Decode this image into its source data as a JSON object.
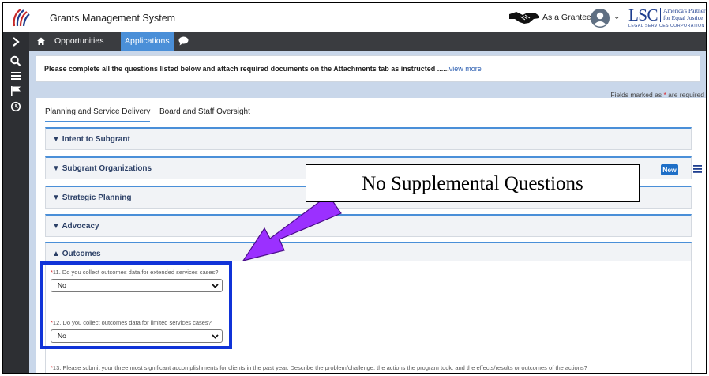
{
  "header": {
    "app_title": "Grants Management System",
    "role_label": "As a Grantee",
    "org_logo": {
      "abbr": "LSC",
      "line1": "America's Partner",
      "line2": "for Equal Justice",
      "line3": "LEGAL SERVICES CORPORATION"
    }
  },
  "nav": {
    "items": [
      {
        "label": "Opportunities"
      },
      {
        "label": "Applications"
      }
    ]
  },
  "notice": {
    "text": "Please complete all the questions listed below and attach required documents on the Attachments tab as instructed ......",
    "link": "view more"
  },
  "required_note": {
    "prefix": "Fields marked as",
    "asterisk": "*",
    "suffix": "are required"
  },
  "tabs": [
    {
      "label": "Planning and Service Delivery"
    },
    {
      "label": "Board and Staff Oversight"
    }
  ],
  "sections": [
    {
      "label": "Intent to Subgrant"
    },
    {
      "label": "Subgrant Organizations"
    },
    {
      "label": "Strategic Planning"
    },
    {
      "label": "Advocacy"
    },
    {
      "label": "Outcomes"
    }
  ],
  "new_button": "New",
  "questions": [
    {
      "asterisk": "*",
      "text": "11. Do you collect outcomes data for extended services cases?",
      "value": "No"
    },
    {
      "asterisk": "*",
      "text": "12. Do you collect outcomes data for limited services cases?",
      "value": "No"
    },
    {
      "asterisk": "*",
      "text": "13. Please submit your three most significant accomplishments for clients in the past year. Describe the problem/challenge, the actions the program took, and the effects/results or outcomes of the actions?"
    }
  ],
  "callout": "No Supplemental Questions",
  "colors": {
    "accent": "#4a8fd8",
    "nav_dark": "#3a3c40",
    "sidebar": "#2d2f33",
    "content_bg": "#c9d7ea",
    "highlight": "#1033d8",
    "arrow": "#9b30ff"
  }
}
